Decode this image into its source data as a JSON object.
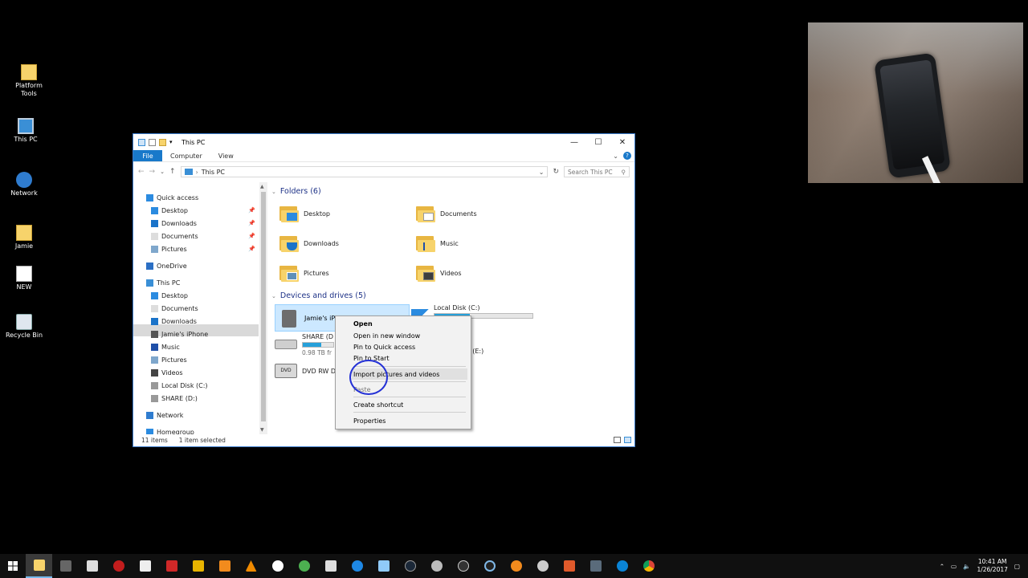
{
  "desktop": {
    "icons": [
      {
        "label": "Platform\nTools",
        "name": "platform-tools"
      },
      {
        "label": "This PC",
        "name": "this-pc"
      },
      {
        "label": "Network",
        "name": "network"
      },
      {
        "label": "Jamie",
        "name": "jamie"
      },
      {
        "label": "NEW",
        "name": "new"
      },
      {
        "label": "Recycle Bin",
        "name": "recycle-bin"
      }
    ]
  },
  "window": {
    "title": "This PC",
    "ribbon": {
      "file": "File",
      "computer": "Computer",
      "view": "View"
    },
    "address": "This PC",
    "search_placeholder": "Search This PC",
    "controls": {
      "minimize": "—",
      "maximize": "☐",
      "close": "✕"
    }
  },
  "nav": {
    "items": [
      {
        "label": "Quick access",
        "icon": "star-icon",
        "indent": 0,
        "pinned": false
      },
      {
        "label": "Desktop",
        "icon": "desktop-icon",
        "indent": 1,
        "pinned": true
      },
      {
        "label": "Downloads",
        "icon": "download-icon",
        "indent": 1,
        "pinned": true
      },
      {
        "label": "Documents",
        "icon": "documents-icon",
        "indent": 1,
        "pinned": true
      },
      {
        "label": "Pictures",
        "icon": "pictures-icon",
        "indent": 1,
        "pinned": true
      },
      {
        "label": "OneDrive",
        "icon": "cloud-icon",
        "indent": 0,
        "pinned": false
      },
      {
        "label": "This PC",
        "icon": "computer-icon",
        "indent": 0,
        "pinned": false
      },
      {
        "label": "Desktop",
        "icon": "desktop-icon",
        "indent": 1,
        "pinned": false
      },
      {
        "label": "Documents",
        "icon": "documents-icon",
        "indent": 1,
        "pinned": false
      },
      {
        "label": "Downloads",
        "icon": "download-icon",
        "indent": 1,
        "pinned": false
      },
      {
        "label": "Jamie's iPhone",
        "icon": "phone-icon",
        "indent": 1,
        "pinned": false
      },
      {
        "label": "Music",
        "icon": "music-icon",
        "indent": 1,
        "pinned": false
      },
      {
        "label": "Pictures",
        "icon": "pictures-icon",
        "indent": 1,
        "pinned": false
      },
      {
        "label": "Videos",
        "icon": "videos-icon",
        "indent": 1,
        "pinned": false
      },
      {
        "label": "Local Disk (C:)",
        "icon": "disk-icon",
        "indent": 1,
        "pinned": false
      },
      {
        "label": "SHARE (D:)",
        "icon": "disk-icon",
        "indent": 1,
        "pinned": false
      },
      {
        "label": "Network",
        "icon": "network-icon",
        "indent": 0,
        "pinned": false
      },
      {
        "label": "Homegroup",
        "icon": "homegroup-icon",
        "indent": 0,
        "pinned": false
      }
    ]
  },
  "content": {
    "folders_header": "Folders (6)",
    "folders": [
      "Desktop",
      "Documents",
      "Downloads",
      "Music",
      "Pictures",
      "Videos"
    ],
    "devices_header": "Devices and drives (5)",
    "drives": {
      "iphone": {
        "label": "Jamie's iP"
      },
      "local_c": {
        "label": "Local Disk (C:)",
        "free": "e of 118 GB",
        "used_fraction": 0.36
      },
      "share_d": {
        "label": "SHARE (D",
        "free": "0.98 TB fr",
        "used_fraction": 0.6
      },
      "dvd": {
        "label": "DVD RW D"
      },
      "drive_e": {
        "label": "ve (E:)"
      }
    }
  },
  "status": {
    "count": "11 items",
    "selected": "1 item selected"
  },
  "context_menu": {
    "items": [
      "Open",
      "Open in new window",
      "Pin to Quick access",
      "Pin to Start",
      "Import pictures and videos",
      "Paste",
      "Create shortcut",
      "Properties"
    ]
  },
  "taskbar": {
    "time": "10:41 AM",
    "date": "1/26/2017"
  },
  "colors": {
    "accent": "#1979ca",
    "selection": "#cce8ff",
    "folder": "#f7d36b",
    "bar": "#26a0da"
  }
}
